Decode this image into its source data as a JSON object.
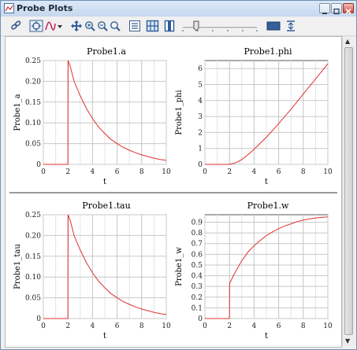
{
  "window": {
    "title": "Probe Plots"
  },
  "toolbar": {
    "tools": [
      "link-icon",
      "auto-scale-icon",
      "probe-style-icon",
      "dropdown-arrow-icon",
      "pan-icon",
      "zoom-in-icon",
      "zoom-out-icon",
      "zoom-reset-icon",
      "list-view-icon",
      "grid-view-icon",
      "single-column-icon",
      "slider-track",
      "color-swatch",
      "export-icon"
    ],
    "slider_value": 0.18
  },
  "chart_data": [
    {
      "type": "line",
      "title": "Probe1.a",
      "xlabel": "t",
      "ylabel": "Probe1_a",
      "xlim": [
        0,
        10
      ],
      "ylim": [
        0,
        0.25
      ],
      "xticks": [
        0,
        2,
        4,
        6,
        8,
        10
      ],
      "yticks": [
        0,
        0.05,
        0.1,
        0.15,
        0.2,
        0.25
      ],
      "yticklabels": [
        "0",
        "0.05",
        "0.10",
        "0.15",
        "0.20",
        "0.25"
      ],
      "grid": true,
      "series": [
        {
          "color": "#e03030",
          "x": [
            0,
            2,
            2.01,
            2.2,
            2.5,
            3,
            3.5,
            4,
            4.5,
            5,
            5.5,
            6,
            6.5,
            7,
            7.5,
            8,
            8.5,
            9,
            9.5,
            10
          ],
          "y": [
            0,
            0,
            0.25,
            0.235,
            0.2,
            0.165,
            0.135,
            0.11,
            0.09,
            0.074,
            0.06,
            0.05,
            0.041,
            0.034,
            0.028,
            0.023,
            0.019,
            0.015,
            0.012,
            0.01
          ]
        }
      ]
    },
    {
      "type": "line",
      "title": "Probe1.phi",
      "xlabel": "t",
      "ylabel": "Probe1_phi",
      "xlim": [
        0,
        10
      ],
      "ylim": [
        0,
        6.5
      ],
      "xticks": [
        0,
        2,
        4,
        6,
        8,
        10
      ],
      "yticks": [
        0,
        1,
        2,
        3,
        4,
        5,
        6
      ],
      "yticklabels": [
        "0",
        "1",
        "2",
        "3",
        "4",
        "5",
        "6"
      ],
      "grid": true,
      "series": [
        {
          "color": "#e03030",
          "x": [
            0,
            2,
            2.5,
            3,
            3.5,
            4,
            5,
            6,
            7,
            8,
            9,
            10
          ],
          "y": [
            0,
            0,
            0.1,
            0.3,
            0.6,
            0.95,
            1.7,
            2.55,
            3.45,
            4.4,
            5.35,
            6.3
          ]
        }
      ]
    },
    {
      "type": "line",
      "title": "Probe1.tau",
      "xlabel": "t",
      "ylabel": "Probe1_tau",
      "xlim": [
        0,
        10
      ],
      "ylim": [
        0,
        0.25
      ],
      "xticks": [
        0,
        2,
        4,
        6,
        8,
        10
      ],
      "yticks": [
        0,
        0.05,
        0.1,
        0.15,
        0.2,
        0.25
      ],
      "yticklabels": [
        "0",
        "0.05",
        "0.10",
        "0.15",
        "0.20",
        "0.25"
      ],
      "grid": true,
      "series": [
        {
          "color": "#e03030",
          "x": [
            0,
            2,
            2.01,
            2.2,
            2.5,
            3,
            3.5,
            4,
            4.5,
            5,
            5.5,
            6,
            6.5,
            7,
            7.5,
            8,
            8.5,
            9,
            9.5,
            10
          ],
          "y": [
            0,
            0,
            0.25,
            0.235,
            0.2,
            0.165,
            0.135,
            0.11,
            0.09,
            0.074,
            0.06,
            0.05,
            0.041,
            0.034,
            0.028,
            0.023,
            0.019,
            0.015,
            0.012,
            0.01
          ]
        }
      ]
    },
    {
      "type": "line",
      "title": "Probe1.w",
      "xlabel": "t",
      "ylabel": "Probe1_w",
      "xlim": [
        0,
        10
      ],
      "ylim": [
        0,
        0.97
      ],
      "xticks": [
        0,
        2,
        4,
        6,
        8,
        10
      ],
      "yticks": [
        0,
        0.1,
        0.2,
        0.3,
        0.4,
        0.5,
        0.6,
        0.7,
        0.8,
        0.9
      ],
      "yticklabels": [
        "0",
        "0.1",
        "0.2",
        "0.3",
        "0.4",
        "0.5",
        "0.6",
        "0.7",
        "0.8",
        "0.9"
      ],
      "grid": true,
      "series": [
        {
          "color": "#e03030",
          "x": [
            0,
            2,
            2.01,
            2.5,
            3,
            3.5,
            4,
            4.5,
            5,
            5.5,
            6,
            6.5,
            7,
            7.5,
            8,
            8.5,
            9,
            9.5,
            10
          ],
          "y": [
            0,
            0,
            0.33,
            0.44,
            0.54,
            0.62,
            0.68,
            0.73,
            0.775,
            0.81,
            0.84,
            0.865,
            0.885,
            0.905,
            0.92,
            0.93,
            0.94,
            0.945,
            0.95
          ]
        }
      ]
    }
  ]
}
